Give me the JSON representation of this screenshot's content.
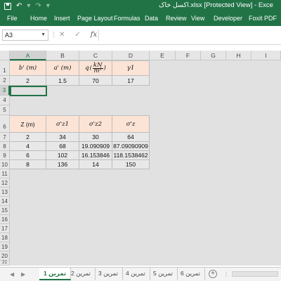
{
  "title_bar": {
    "title": "اکسل خاک.xlsx  [Protected View]  -  Exce"
  },
  "ribbon": {
    "tabs": [
      "File",
      "Home",
      "Insert",
      "Page Layout",
      "Formulas",
      "Data",
      "Review",
      "View",
      "Developer",
      "Foxit PDF"
    ]
  },
  "formula_bar": {
    "name_box": "A3",
    "formula": ""
  },
  "grid": {
    "columns": [
      "A",
      "B",
      "C",
      "D",
      "E",
      "F",
      "G",
      "H",
      "I"
    ],
    "rows": [
      "1",
      "2",
      "3",
      "4",
      "5",
      "6",
      "7",
      "8",
      "9",
      "10",
      "11",
      "12",
      "13",
      "14",
      "15",
      "16",
      "17",
      "18",
      "19",
      "20",
      "21",
      "22"
    ],
    "table1": {
      "headers": [
        "b' (m)",
        "a' (m)",
        "q",
        "γ1"
      ],
      "q_unit_num": "kN",
      "q_unit_den": "m²",
      "values": [
        "2",
        "1.5",
        "70",
        "17"
      ]
    },
    "table2": {
      "headers": [
        "Z (m)",
        "σ'z1",
        "σ'z2",
        "σ'z"
      ],
      "rows": [
        [
          "2",
          "34",
          "30",
          "64"
        ],
        [
          "4",
          "68",
          "19.090909",
          "87.09090909"
        ],
        [
          "6",
          "102",
          "16.153846",
          "118.1538462"
        ],
        [
          "8",
          "136",
          "14",
          "150"
        ]
      ]
    }
  },
  "sheet_tabs": {
    "tabs": [
      "تمرین 1",
      "تمرین 2",
      "تمرین 3",
      "تمرین 4",
      "تمرین 5",
      "تمرین 6"
    ],
    "active": "تمرین 1"
  },
  "colors": {
    "brand": "#217346",
    "header_fill": "#fbe3d6",
    "data_fill": "#e8e8e8"
  }
}
